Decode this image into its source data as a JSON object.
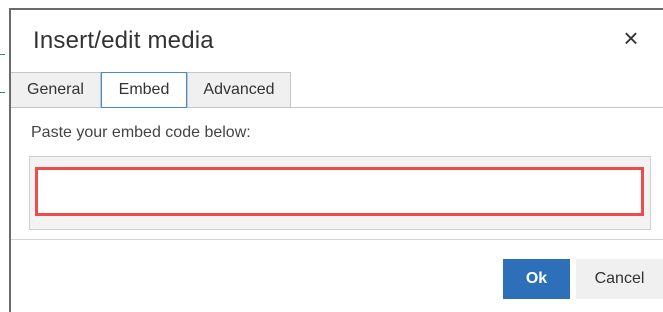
{
  "dialog": {
    "title": "Insert/edit media",
    "close_glyph": "×"
  },
  "tabs": [
    {
      "label": "General",
      "active": false
    },
    {
      "label": "Embed",
      "active": true
    },
    {
      "label": "Advanced",
      "active": false
    }
  ],
  "embed": {
    "label": "Paste your embed code below:",
    "value": "",
    "highlight_color": "#ef4b4b"
  },
  "footer": {
    "ok_label": "Ok",
    "cancel_label": "Cancel"
  },
  "colors": {
    "primary_button": "#2d6fb8",
    "active_tab_border": "#3d8edb"
  },
  "icons": {
    "close": "close-icon"
  }
}
